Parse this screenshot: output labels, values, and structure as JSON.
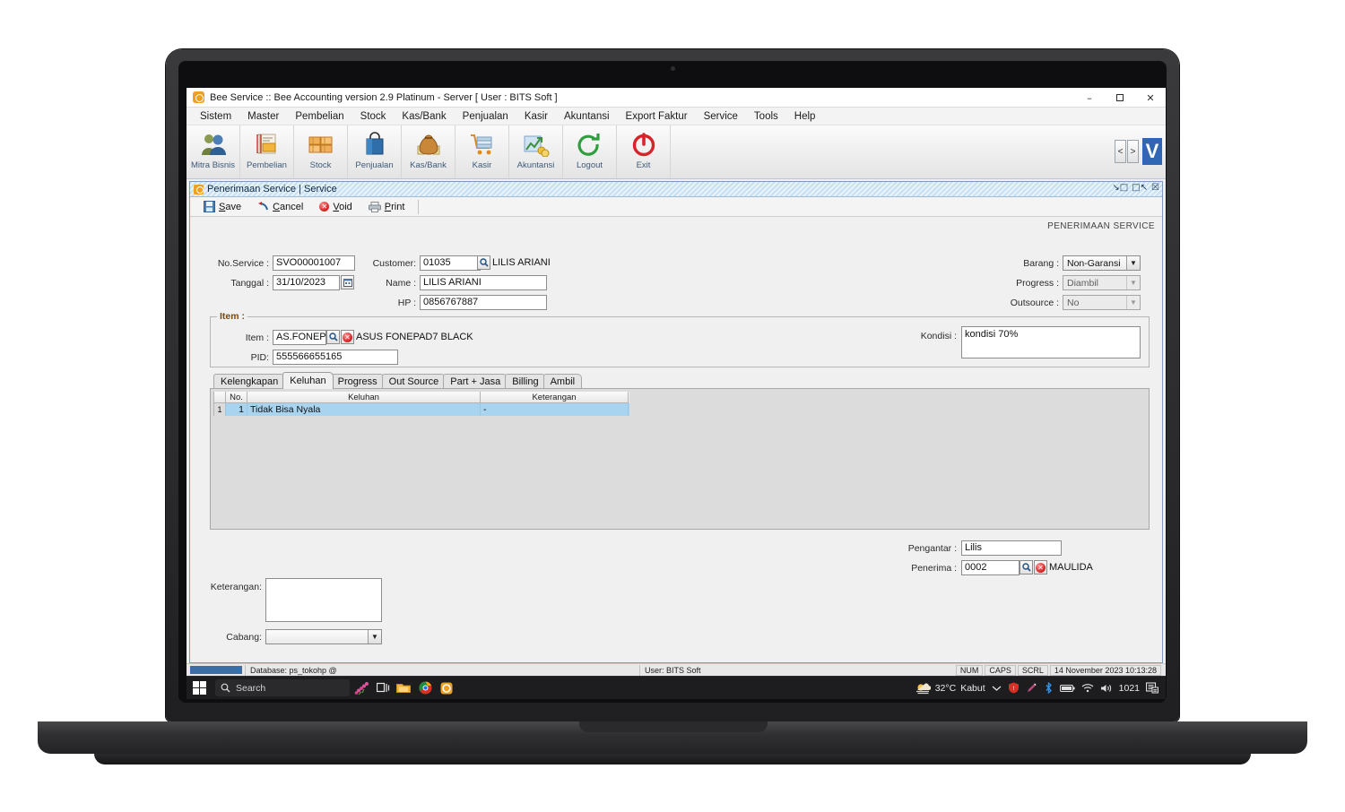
{
  "window": {
    "title": "Bee Service :: Bee Accounting version 2.9 Platinum - Server  [ User : BITS Soft ]",
    "minimize": "–",
    "maximize": "❐",
    "close": "✕"
  },
  "menubar": {
    "items": [
      {
        "label": "Sistem"
      },
      {
        "label": "Master"
      },
      {
        "label": "Pembelian"
      },
      {
        "label": "Stock"
      },
      {
        "label": "Kas/Bank"
      },
      {
        "label": "Penjualan"
      },
      {
        "label": "Kasir"
      },
      {
        "label": "Akuntansi"
      },
      {
        "label": "Export Faktur"
      },
      {
        "label": "Service"
      },
      {
        "label": "Tools"
      },
      {
        "label": "Help"
      }
    ]
  },
  "toolbar": {
    "items": [
      {
        "label": "Mitra Bisnis",
        "icon": "people-icon"
      },
      {
        "label": "Pembelian",
        "icon": "purchase-book-icon"
      },
      {
        "label": "Stock",
        "icon": "boxes-icon"
      },
      {
        "label": "Penjualan",
        "icon": "shopping-bag-icon"
      },
      {
        "label": "Kas/Bank",
        "icon": "money-bag-icon"
      },
      {
        "label": "Kasir",
        "icon": "cart-icon"
      },
      {
        "label": "Akuntansi",
        "icon": "chart-coins-icon"
      },
      {
        "label": "Logout",
        "icon": "logout-arrow-icon"
      },
      {
        "label": "Exit",
        "icon": "power-icon"
      }
    ],
    "nav_prev": "<",
    "nav_next": ">",
    "badge": "V"
  },
  "mdi": {
    "title": "Penerimaan Service | Service",
    "banner": "PENERIMAAN SERVICE",
    "controls": [
      "restore-down-icon",
      "maximize-icon",
      "close-icon"
    ],
    "actions": [
      {
        "label": "Save",
        "accel": "S",
        "icon": "save-disk-icon"
      },
      {
        "label": "Cancel",
        "accel": "C",
        "icon": "undo-arrow-icon"
      },
      {
        "label": "Void",
        "accel": "V",
        "icon": "void-circle-icon"
      },
      {
        "label": "Print",
        "accel": "P",
        "icon": "printer-icon"
      }
    ]
  },
  "form": {
    "no_service_label": "No.Service :",
    "no_service_value": "SVO00001007",
    "tanggal_label": "Tanggal :",
    "tanggal_value": "31/10/2023",
    "customer_label": "Customer:",
    "customer_code": "01035",
    "customer_name_display": "LILIS ARIANI",
    "name_label": "Name :",
    "name_value": "LILIS ARIANI",
    "hp_label": "HP :",
    "hp_value": "0856767887",
    "barang_label": "Barang :",
    "barang_value": "Non-Garansi",
    "progress_label": "Progress :",
    "progress_value": "Diambil",
    "outsource_label": "Outsource :",
    "outsource_value": "No",
    "item_group_title": "Item :",
    "item_label": "Item :",
    "item_value": "AS.FONEPAD",
    "item_display": "ASUS FONEPAD7 BLACK",
    "pid_label": "PID:",
    "pid_value": "555566655165",
    "kondisi_label": "Kondisi :",
    "kondisi_value": "kondisi 70%",
    "pengantar_label": "Pengantar :",
    "pengantar_value": "Lilis",
    "penerima_label": "Penerima :",
    "penerima_code": "0002",
    "penerima_name": "MAULIDA",
    "keterangan_label": "Keterangan:",
    "keterangan_value": "",
    "cabang_label": "Cabang:",
    "cabang_value": ""
  },
  "tabs": [
    {
      "label": "Kelengkapan",
      "active": false
    },
    {
      "label": "Keluhan",
      "active": true
    },
    {
      "label": "Progress",
      "active": false
    },
    {
      "label": "Out Source",
      "active": false
    },
    {
      "label": "Part + Jasa",
      "active": false
    },
    {
      "label": "Billing",
      "active": false
    },
    {
      "label": "Ambil",
      "active": false
    }
  ],
  "grid": {
    "row_header": "1",
    "columns": [
      "No.",
      "Keluhan",
      "Keterangan"
    ],
    "rows": [
      {
        "no": "1",
        "keluhan": "Tidak Bisa Nyala",
        "keterangan": "-"
      }
    ]
  },
  "statusbar": {
    "database": "Database: ps_tokohp @",
    "user": "User: BITS Soft",
    "num": "NUM",
    "caps": "CAPS",
    "scrl": "SCRL",
    "datetime": "14 November 2023  10:13:28"
  },
  "taskbar": {
    "search_placeholder": "Search",
    "weather_temp": "32°C",
    "weather_desc": "Kabut",
    "clock": "1021",
    "icons": [
      "windows-start-icon",
      "search-icon",
      "task-view-icon",
      "file-explorer-icon",
      "chrome-icon",
      "bee-app-icon",
      "chevron-up-icon",
      "security-icon",
      "pen-icon",
      "bluetooth-icon",
      "battery-icon",
      "wifi-icon",
      "volume-icon",
      "notification-icon"
    ]
  },
  "colors": {
    "accent_blue": "#2f67b4",
    "grid_selection": "#a8d4f0",
    "mdi_title": "#c7e0f4",
    "toolbar_label": "#3f5a78",
    "group_title": "#7a4a12"
  }
}
